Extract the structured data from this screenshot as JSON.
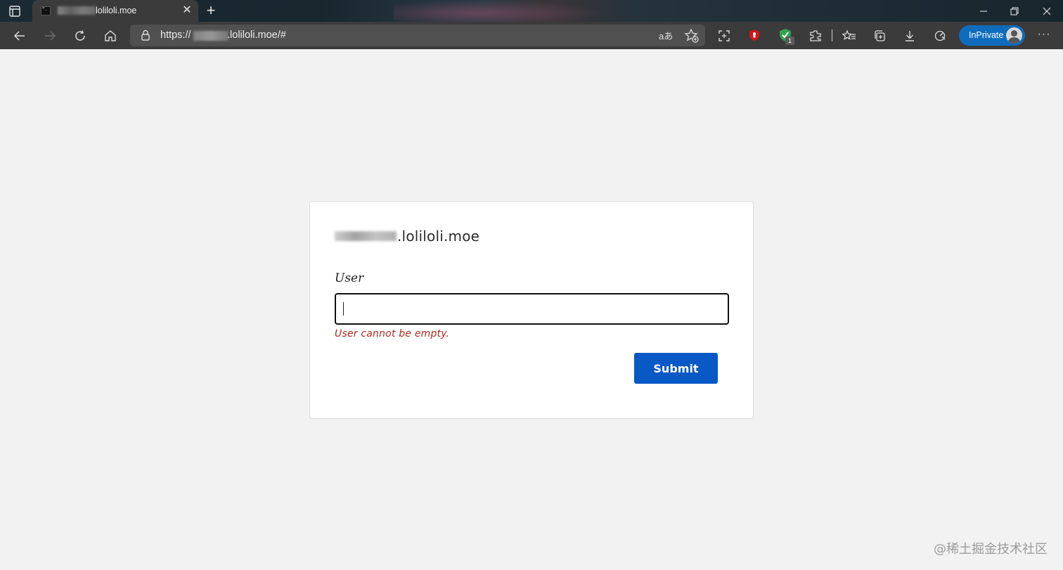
{
  "browser": {
    "tab": {
      "title": "loliloli.moe",
      "close_symbol": "✕"
    },
    "new_tab_symbol": "+",
    "address": {
      "url_prefix": "https://",
      "url_suffix": ".loliloli.moe/#"
    },
    "read_aloud_label": "aあ",
    "extension_badge_count": "1",
    "inprivate_label": "InPrivate",
    "more_symbol": "···"
  },
  "page": {
    "site_title": ".loliloli.moe",
    "user_label": "User",
    "user_input_value": "",
    "error_message": "User cannot be empty.",
    "submit_label": "Submit"
  },
  "watermark": "@稀土掘金技术社区",
  "colors": {
    "accent": "#0858c6",
    "error": "#b3261e",
    "inprivate": "#0f6cbd",
    "page_background": "#f2f2f2"
  },
  "icons": [
    "tab-actions-icon",
    "back-icon",
    "forward-icon",
    "refresh-icon",
    "home-icon",
    "lock-icon",
    "add-favorite-icon",
    "screenshot-icon",
    "extension-red-icon",
    "extension-shield-icon",
    "extensions-icon",
    "favorites-icon",
    "collections-icon",
    "downloads-icon",
    "performance-icon",
    "avatar-icon",
    "more-icon"
  ]
}
